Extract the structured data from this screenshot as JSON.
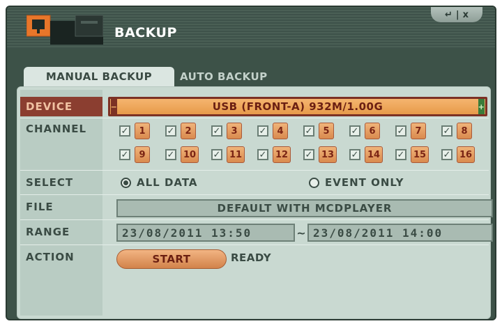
{
  "window": {
    "title": "BACKUP",
    "controls": {
      "enter_glyph": "↵",
      "separator": "|",
      "close_glyph": "x"
    }
  },
  "tabs": [
    {
      "label": "MANUAL BACKUP",
      "active": true
    },
    {
      "label": "AUTO BACKUP",
      "active": false
    }
  ],
  "rows": {
    "device": "DEVICE",
    "channel": "CHANNEL",
    "select": "SELECT",
    "file": "FILE",
    "range": "RANGE",
    "action": "ACTION"
  },
  "device": {
    "value": "USB (FRONT-A) 932M/1.00G",
    "minus": "−",
    "plus": "+"
  },
  "channels": [
    {
      "num": "1",
      "checked": true
    },
    {
      "num": "2",
      "checked": true
    },
    {
      "num": "3",
      "checked": true
    },
    {
      "num": "4",
      "checked": true
    },
    {
      "num": "5",
      "checked": true
    },
    {
      "num": "6",
      "checked": true
    },
    {
      "num": "7",
      "checked": true
    },
    {
      "num": "8",
      "checked": true
    },
    {
      "num": "9",
      "checked": true
    },
    {
      "num": "10",
      "checked": true
    },
    {
      "num": "11",
      "checked": true
    },
    {
      "num": "12",
      "checked": true
    },
    {
      "num": "13",
      "checked": true
    },
    {
      "num": "14",
      "checked": true
    },
    {
      "num": "15",
      "checked": true
    },
    {
      "num": "16",
      "checked": true
    }
  ],
  "select": {
    "all_data": "ALL DATA",
    "event_only": "EVENT ONLY",
    "selected": "all_data"
  },
  "file": {
    "value": "DEFAULT WITH MCDPLAYER"
  },
  "range": {
    "from": "23/08/2011  13:50",
    "separator": "~",
    "to": "23/08/2011  14:00"
  },
  "action": {
    "start_label": "START",
    "status": "READY"
  },
  "icons": {
    "app": "backup-disk-icon",
    "check": "✓"
  },
  "colors": {
    "accent_orange": "#e79a4a",
    "device_dark": "#7c3124",
    "panel_bg": "#c9d9d1",
    "window_bg": "#3d5248"
  }
}
